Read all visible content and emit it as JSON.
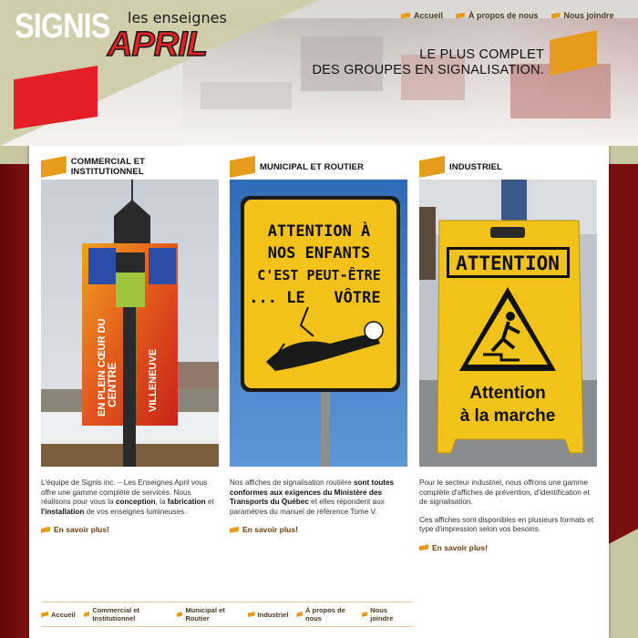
{
  "brand": {
    "signis": "SIGNIS",
    "april_small": "les enseignes",
    "april_big": "APRIL"
  },
  "nav": {
    "items": [
      {
        "label": "Accueil"
      },
      {
        "label": "À propos de nous"
      },
      {
        "label": "Nous joindre"
      }
    ]
  },
  "slogan": {
    "line1": "LE PLUS COMPLET",
    "line2": "DES GROUPES EN SIGNALISATION."
  },
  "columns": [
    {
      "title": "COMMERCIAL ET INSTITUTIONNEL",
      "sign_text": [
        "EN PLEIN CŒUR DU",
        "CENTRE",
        "VILLENEUVE"
      ],
      "text_parts": [
        "L'équipe de Signis inc. – Les Enseignes April vous offre une gamme complète de services. Nous réalisons pour vous la ",
        "conception",
        ", la ",
        "fabrication",
        " et ",
        "l'installation",
        " de vos enseignes lumineuses."
      ],
      "more": "En savoir plus!"
    },
    {
      "title": "MUNICIPAL ET ROUTIER",
      "sign_lines": [
        "ATTENTION À",
        "NOS ENFANTS",
        "C'EST PEUT-ÊTRE",
        "... LE",
        "VÔTRE"
      ],
      "text_parts": [
        "Nos affiches de signalisation routière ",
        "sont toutes conformes aux exigences du Ministère des Transports du Québec",
        " et elles répondent aux paramètres du manuel de référence Tome V."
      ],
      "more": "En savoir plus!"
    },
    {
      "title": "INDUSTRIEL",
      "sign_head": "ATTENTION",
      "sign_line1": "Attention",
      "sign_line2": "à la marche",
      "text1": "Pour le secteur industriel, nous offrons une gamme complète d'affiches de prévention, d'identification et de signalisation.",
      "text2": "Ces affiches sont disponibles en plusieurs formats et type d'impression selon vos besoins.",
      "more": "En savoir plus!"
    }
  ],
  "footer": {
    "items": [
      {
        "label": "Accueil"
      },
      {
        "label": "Commercial et Institutionnel"
      },
      {
        "label": "Municipal et Routier"
      },
      {
        "label": "Industriel"
      },
      {
        "label": "À propos de nous"
      },
      {
        "label": "Nous joindre"
      }
    ]
  },
  "colors": {
    "accent": "#e69c1a",
    "brand_red": "#e32025",
    "background": "#7a0d0d",
    "olive": "#c9c7a2"
  }
}
